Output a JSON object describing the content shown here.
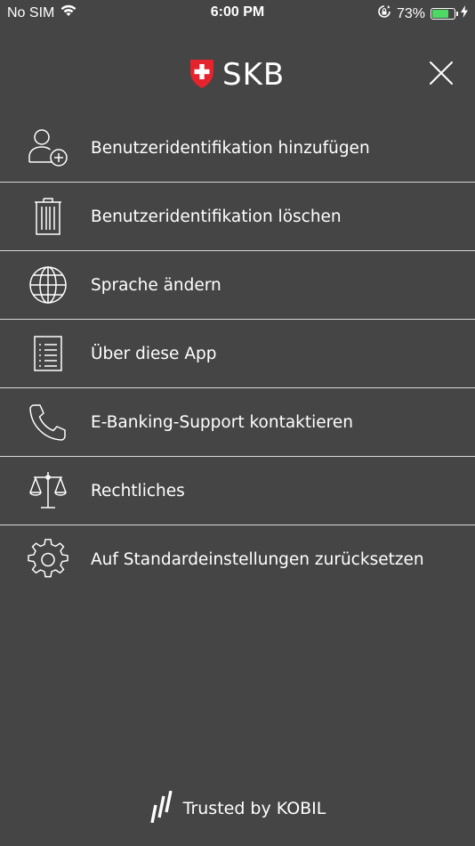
{
  "status_bar": {
    "carrier": "No SIM",
    "time": "6:00 PM",
    "battery_percent": "73%",
    "battery_level": 0.73,
    "battery_color": "#4cd964"
  },
  "header": {
    "logo_text": "SKB",
    "logo_icon": "swiss-shield-icon",
    "close_icon": "close-icon"
  },
  "menu": {
    "items": [
      {
        "label": "Benutzeridentifikation hinzufügen",
        "icon": "add-user-icon"
      },
      {
        "label": "Benutzeridentifikation löschen",
        "icon": "trash-icon"
      },
      {
        "label": "Sprache ändern",
        "icon": "globe-icon"
      },
      {
        "label": "Über diese App",
        "icon": "document-list-icon"
      },
      {
        "label": "E-Banking-Support kontaktieren",
        "icon": "phone-icon"
      },
      {
        "label": "Rechtliches",
        "icon": "scales-icon"
      },
      {
        "label": "Auf Standardeinstellungen zurücksetzen",
        "icon": "gear-icon"
      }
    ]
  },
  "footer": {
    "text": "Trusted by KOBIL",
    "icon": "kobil-logo-icon"
  },
  "colors": {
    "background": "#444544",
    "divider": "#d8d8d8",
    "logo_red": "#e5232d"
  }
}
